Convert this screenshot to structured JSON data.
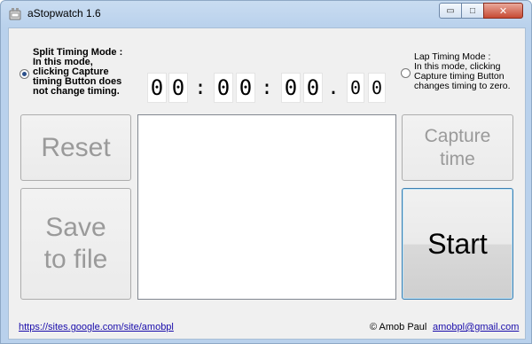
{
  "window": {
    "title": "aStopwatch 1.6",
    "minimize_icon": "minimize-icon",
    "maximize_icon": "maximize-icon",
    "close_icon": "close-icon",
    "minimize_glyph": "▭",
    "maximize_glyph": "□",
    "close_glyph": "✕"
  },
  "split_mode": {
    "lines": [
      "Split Timing Mode :",
      "In this mode,",
      "clicking Capture",
      "timing Button does",
      "not change timing."
    ],
    "checked": true
  },
  "lap_mode": {
    "lines": [
      "Lap Timing Mode :",
      "In this mode, clicking",
      "Capture timing Button",
      "changes timing to zero."
    ],
    "checked": false
  },
  "timer": {
    "h1": "0",
    "h2": "0",
    "sep1": ":",
    "m1": "0",
    "m2": "0",
    "sep2": ":",
    "s1": "0",
    "s2": "0",
    "sep3": ".",
    "c1": "0",
    "c2": "0"
  },
  "buttons": {
    "reset": "Reset",
    "save_line1": "Save",
    "save_line2": "to file",
    "capture_line1": "Capture",
    "capture_line2": "time",
    "start": "Start"
  },
  "footer": {
    "url": "https://sites.google.com/site/amobpl",
    "copyright": "© Amob Paul",
    "email": "amobpl@gmail.com"
  },
  "colors": {
    "frame": "#b9d1ec",
    "client": "#f0f0f0",
    "start_border": "#3c7fb1",
    "close_button": "#c74a33"
  }
}
